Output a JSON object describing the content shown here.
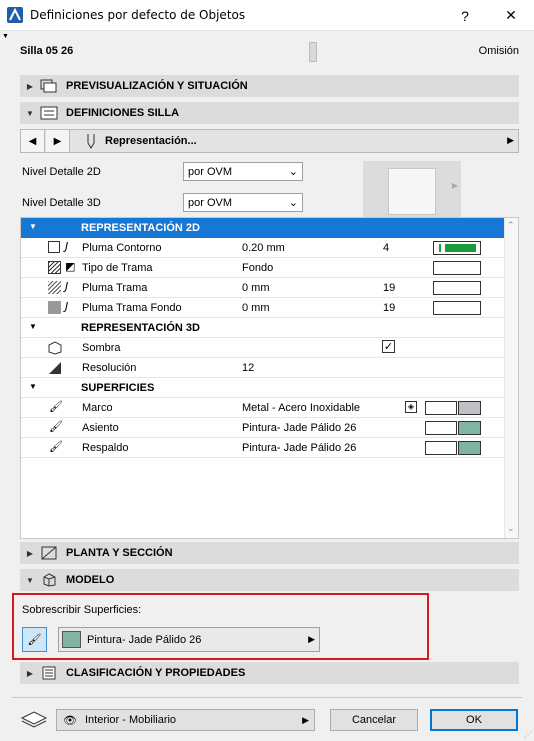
{
  "window": {
    "title": "Definiciones por defecto de Objetos",
    "help_glyph": "?",
    "close_glyph": "✕"
  },
  "header": {
    "object_name": "Silla 05 26",
    "default_label": "Omisión"
  },
  "sections": {
    "preview": "PREVISUALIZACIÓN Y SITUACIÓN",
    "chair": "DEFINICIONES SILLA",
    "plan": "PLANTA Y SECCIÓN",
    "model": "MODELO",
    "classification": "CLASIFICACIÓN Y PROPIEDADES"
  },
  "nav": {
    "label": "Representación..."
  },
  "detail": {
    "level2d_label": "Nivel Detalle 2D",
    "level2d_value": "por OVM",
    "level3d_label": "Nivel Detalle 3D",
    "level3d_value": "por OVM"
  },
  "table": {
    "rep2d": "REPRESENTACIÓN 2D",
    "rep3d": "REPRESENTACIÓN 3D",
    "surfaces": "SUPERFICIES",
    "rows": [
      {
        "name": "Pluma Contorno",
        "value": "0.20 mm",
        "num": "4"
      },
      {
        "name": "Tipo de Trama",
        "value": "Fondo",
        "num": ""
      },
      {
        "name": "Pluma Trama",
        "value": "0 mm",
        "num": "19"
      },
      {
        "name": "Pluma Trama Fondo",
        "value": "0 mm",
        "num": "19"
      },
      {
        "name": "Sombra",
        "value": "",
        "num": ""
      },
      {
        "name": "Resolución",
        "value": "12",
        "num": ""
      },
      {
        "name": "Marco",
        "value": "Metal - Acero Inoxidable",
        "num": ""
      },
      {
        "name": "Asiento",
        "value": "Pintura- Jade Pálido 26",
        "num": ""
      },
      {
        "name": "Respaldo",
        "value": "Pintura- Jade Pálido 26",
        "num": ""
      }
    ],
    "shadow_check": "✓"
  },
  "override": {
    "label": "Sobrescribir Superficies:",
    "material": "Pintura- Jade Pálido 26"
  },
  "footer": {
    "layer": "Interior - Mobiliario",
    "cancel": "Cancelar",
    "ok": "OK"
  },
  "colors": {
    "selected_header": "#1678d4",
    "jade": "#7fb5a2",
    "metal": "#c0c0c4",
    "pen_green": "#1d9a3a",
    "highlight_border": "#d41a1a"
  }
}
